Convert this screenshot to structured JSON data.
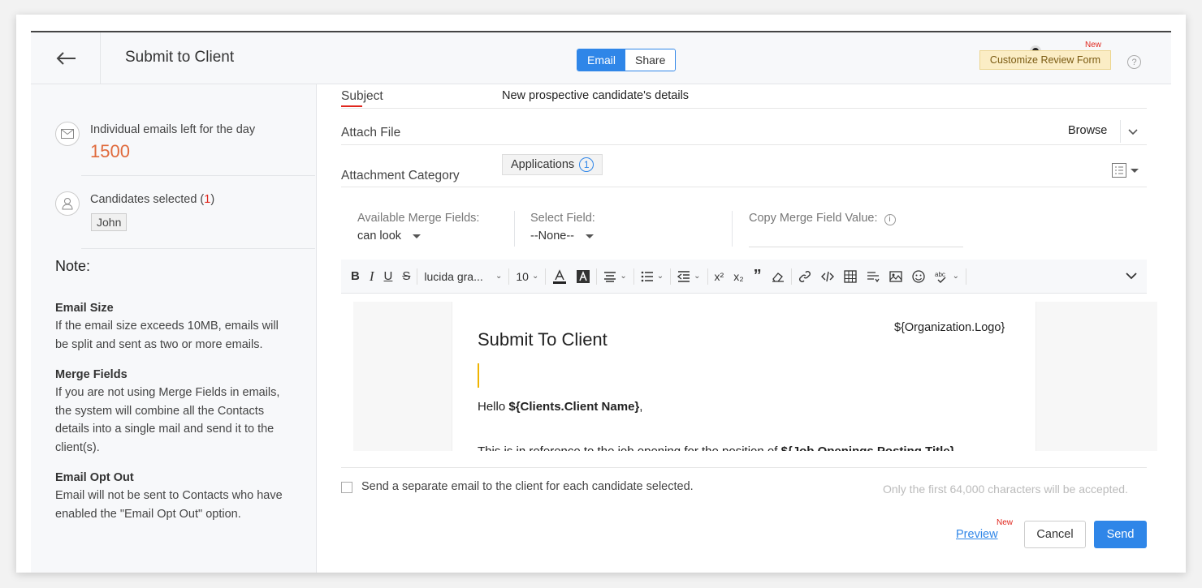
{
  "header": {
    "title": "Submit to Client",
    "tabs": [
      "Email",
      "Share"
    ],
    "customize_label": "Customize Review Form",
    "customize_new": "New",
    "help": "?"
  },
  "sidebar": {
    "emails_left_label": "Individual emails left for the day",
    "emails_left_count": "1500",
    "candidates_label_prefix": "Candidates selected (",
    "candidates_count": "1",
    "candidates_label_suffix": ")",
    "candidate_chip": "John",
    "note_title": "Note:",
    "notes": [
      {
        "heading": "Email Size",
        "text": "If the email size exceeds 10MB, emails will be split and sent as two or more emails."
      },
      {
        "heading": "Merge Fields",
        "text": "If you are not using Merge Fields in emails, the system will combine all the Contacts details into a single mail and send it to the client(s)."
      },
      {
        "heading": "Email Opt Out",
        "text": "Email will not be sent to Contacts who have enabled the \"Email Opt Out\" option."
      }
    ]
  },
  "form": {
    "subject_label": "Subject",
    "subject_value": "New prospective candidate's details",
    "attach_label": "Attach File",
    "browse_label": "Browse",
    "category_label": "Attachment Category",
    "category_chip": "Applications",
    "category_count": "1"
  },
  "merge": {
    "available_label": "Available Merge Fields:",
    "available_value": "can look",
    "select_label": "Select Field:",
    "select_value": "--None--",
    "copy_label": "Copy Merge Field Value:"
  },
  "toolbar": {
    "bold": "B",
    "italic": "I",
    "underline": "U",
    "strike": "S",
    "font_family": "lucida gra...",
    "font_size": "10",
    "superscript": "x²",
    "subscript": "x₂"
  },
  "editor": {
    "title": "Submit To Client",
    "logo_field": "${Organization.Logo}",
    "hello_prefix": "Hello ",
    "hello_field": "${Clients.Client Name}",
    "hello_suffix": ",",
    "ref_prefix": "This is in reference to the job opening for the position of ",
    "ref_field": "${Job Openings.Posting Title}"
  },
  "footer": {
    "separate_email_label": "Send a separate email to the client for each candidate selected.",
    "char_limit": "Only the first 64,000 characters will be accepted.",
    "preview_label": "Preview",
    "preview_new": "New",
    "cancel_label": "Cancel",
    "send_label": "Send"
  },
  "colors": {
    "accent": "#2f86e8",
    "count_orange": "#e06a3c",
    "new_red": "#e0261d"
  }
}
